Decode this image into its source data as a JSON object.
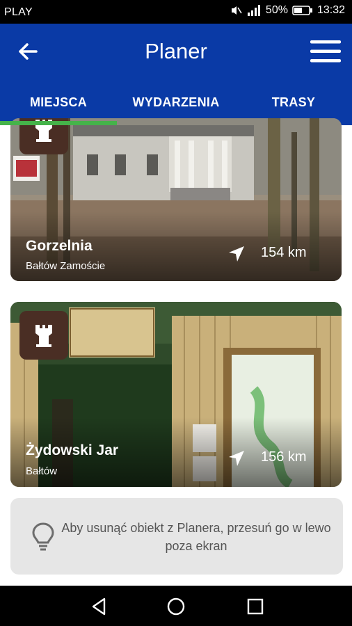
{
  "statusbar": {
    "carrier": "PLAY",
    "battery": "50%",
    "time": "13:32"
  },
  "appbar": {
    "title": "Planer"
  },
  "tabs": [
    {
      "label": "MIEJSCA",
      "active": true
    },
    {
      "label": "WYDARZENIA",
      "active": false
    },
    {
      "label": "TRASY",
      "active": false
    }
  ],
  "places": [
    {
      "name": "Gorzelnia",
      "location": "Bałtów Zamoście",
      "distance": "154 km",
      "icon": "castle-tower-icon"
    },
    {
      "name": "Żydowski Jar",
      "location": "Bałtów",
      "distance": "156 km",
      "icon": "castle-tower-icon"
    }
  ],
  "tip": {
    "text": "Aby usunąć obiekt z Planera, przesuń go w lewo poza ekran"
  },
  "colors": {
    "appbar": "#0a3aa6",
    "tab_indicator": "#45b34a",
    "badge": "#4a2e24",
    "tip_background": "#e6e6e6"
  }
}
